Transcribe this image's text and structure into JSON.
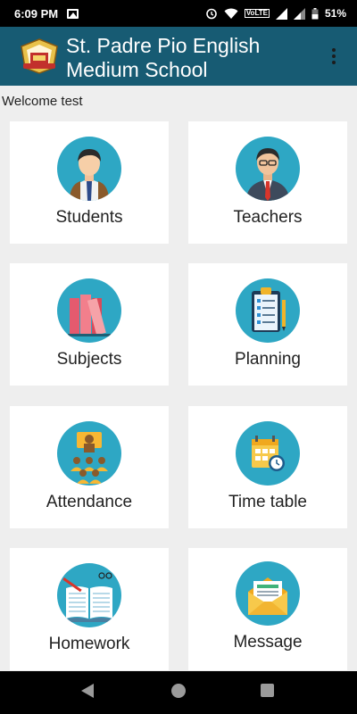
{
  "status_bar": {
    "time": "6:09 PM",
    "network_label": "VoLTE",
    "battery_percent": "51%"
  },
  "app_bar": {
    "title_line1": "St. Padre Pio English",
    "title_line2": "Medium School"
  },
  "welcome_text": "Welcome test",
  "menu_cards": [
    {
      "label": "Students",
      "icon": "student-icon"
    },
    {
      "label": "Teachers",
      "icon": "teacher-icon"
    },
    {
      "label": "Subjects",
      "icon": "books-icon"
    },
    {
      "label": "Planning",
      "icon": "clipboard-icon"
    },
    {
      "label": "Attendance",
      "icon": "attendance-icon"
    },
    {
      "label": "Time table",
      "icon": "calendar-clock-icon"
    },
    {
      "label": "Homework",
      "icon": "notebook-icon"
    },
    {
      "label": "Message",
      "icon": "envelope-icon"
    }
  ],
  "colors": {
    "app_bar": "#175b73",
    "icon_circle": "#2ea7c4",
    "background": "#eeeeee"
  }
}
